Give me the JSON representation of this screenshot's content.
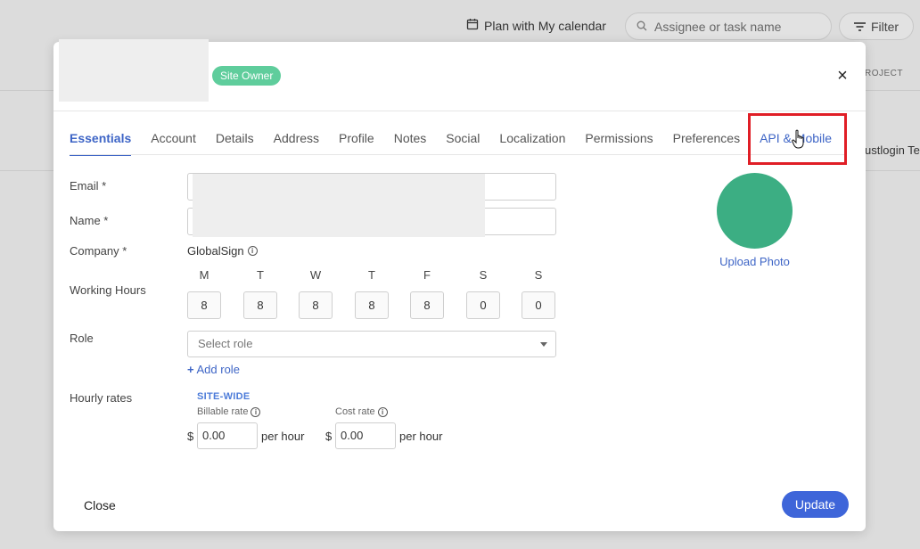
{
  "background": {
    "plan_label": "Plan with My calendar",
    "search_placeholder": "Assignee or task name",
    "filter_label": "Filter",
    "column_header": "ROJECT",
    "row_text": "ustlogin Te"
  },
  "modal": {
    "badge": "Site Owner",
    "close_x": "×",
    "tabs": [
      {
        "label": "Essentials"
      },
      {
        "label": "Account"
      },
      {
        "label": "Details"
      },
      {
        "label": "Address"
      },
      {
        "label": "Profile"
      },
      {
        "label": "Notes"
      },
      {
        "label": "Social"
      },
      {
        "label": "Localization"
      },
      {
        "label": "Permissions"
      },
      {
        "label": "Preferences"
      },
      {
        "label": "API & Mobile"
      }
    ],
    "form": {
      "email_label": "Email *",
      "name_label": "Name *",
      "company_label": "Company *",
      "company_value": "GlobalSign",
      "working_hours_label": "Working Hours",
      "days": [
        {
          "letter": "M",
          "hours": "8"
        },
        {
          "letter": "T",
          "hours": "8"
        },
        {
          "letter": "W",
          "hours": "8"
        },
        {
          "letter": "T",
          "hours": "8"
        },
        {
          "letter": "F",
          "hours": "8"
        },
        {
          "letter": "S",
          "hours": "0"
        },
        {
          "letter": "S",
          "hours": "0"
        }
      ],
      "role_label": "Role",
      "role_placeholder": "Select role",
      "add_role": "Add role",
      "hourly_rates_label": "Hourly rates",
      "site_wide": "SITE-WIDE",
      "billable_rate_label": "Billable rate",
      "cost_rate_label": "Cost rate",
      "currency": "$",
      "billable_value": "0.00",
      "cost_value": "0.00",
      "per_hour": "per hour"
    },
    "upload_photo": "Upload Photo",
    "close_button": "Close",
    "update_button": "Update"
  },
  "colors": {
    "accent": "#3e65c6",
    "badge": "#5fcd9c",
    "avatar": "#3cae83",
    "highlight": "#e01e26"
  }
}
